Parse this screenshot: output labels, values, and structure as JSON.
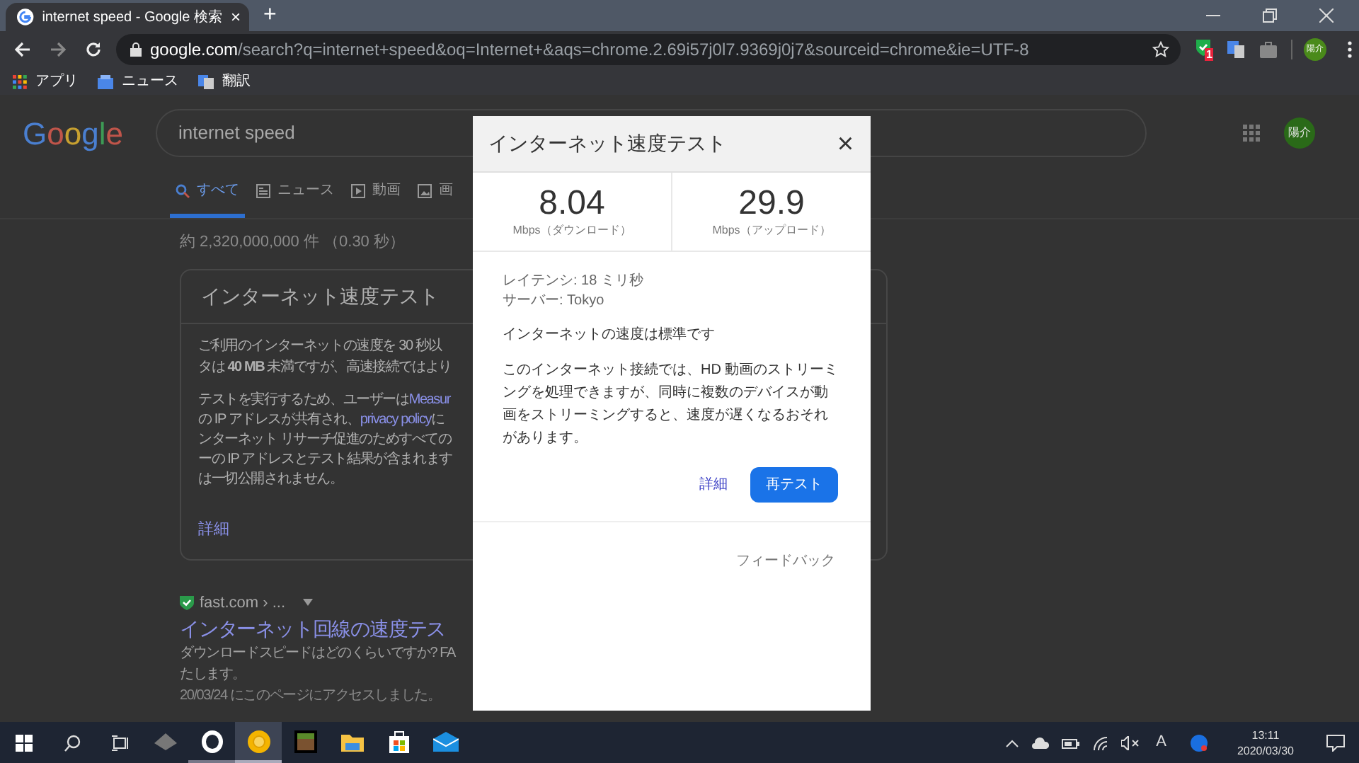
{
  "browser": {
    "tab": {
      "title": "internet speed - Google 検索",
      "close": "×"
    },
    "new_tab": "+",
    "url": {
      "host": "google.com",
      "path": "/search?q=internet+speed&oq=Internet+&aqs=chrome.2.69i57j0l7.9369j0j7&sourceid=chrome&ie=UTF-8"
    },
    "extension_badge": "1",
    "profile": "陽介",
    "bookmarks": [
      {
        "label": "アプリ",
        "kind": "apps"
      },
      {
        "label": "ニュース",
        "kind": "news"
      },
      {
        "label": "翻訳",
        "kind": "translate"
      }
    ]
  },
  "page": {
    "logo": "Google",
    "query": "internet speed",
    "avatar": "陽介",
    "tabs": [
      {
        "label": "すべて",
        "selected": true,
        "kind": "search"
      },
      {
        "label": "ニュース",
        "selected": false,
        "kind": "news"
      },
      {
        "label": "動画",
        "selected": false,
        "kind": "video"
      },
      {
        "label": "画",
        "selected": false,
        "kind": "image"
      }
    ],
    "result_stats": "約 2,320,000,000 件 （0.30 秒）",
    "card": {
      "title": "インターネット速度テスト",
      "paragraph_1": [
        "ご利用のインターネットの速度を 30 秒以",
        "タは **40 MB** 未満ですが、高速接続ではより"
      ],
      "paragraph_2": [
        {
          "text": "テストを実行するため、ユーザーは ",
          "link": "Measur"
        },
        {
          "text": "の IP アドレスが共有され、",
          "link": "privacy policy",
          "after": "に"
        },
        {
          "text": "ンターネット リサーチ促進のためすべての"
        },
        {
          "text": "ーの IP アドレスとテスト結果が含まれます"
        },
        {
          "text": "は一切公開されません。"
        }
      ],
      "details_link": "詳細"
    },
    "result": {
      "site": "fast.com › ...",
      "title": "インターネット回線の速度テス",
      "snippet": [
        "ダウンロードスピードはどのくらいですか? FA",
        "たします。"
      ],
      "visited": "20/03/24 にこのページにアクセスしました。"
    }
  },
  "dialog": {
    "title": "インターネット速度テスト",
    "close": "×",
    "stats": [
      {
        "value": "8.04",
        "label": "Mbps（ダウンロード）"
      },
      {
        "value": "29.9",
        "label": "Mbps（アップロード）"
      }
    ],
    "latency": "レイテンシ: 18 ミリ秒",
    "server": "サーバー: Tokyo",
    "verdict": "インターネットの速度は標準です",
    "description": "このインターネット接続では、HD 動画のストリーミングを処理できますが、同時に複数のデバイスが動画をストリーミングすると、速度が遅くなるおそれがあります。",
    "details_link": "詳細",
    "retest_button": "再テスト",
    "feedback": "フィードバック"
  },
  "taskbar": {
    "apps": [
      {
        "kind": "cube",
        "active": false
      },
      {
        "kind": "ring",
        "active": false
      },
      {
        "kind": "chrome",
        "active": true
      },
      {
        "kind": "block",
        "active": false
      },
      {
        "kind": "folder",
        "active": false
      },
      {
        "kind": "store",
        "active": false
      },
      {
        "kind": "mail",
        "active": false
      }
    ],
    "ime": "A",
    "time": "13:11",
    "date": "2020/03/30"
  }
}
